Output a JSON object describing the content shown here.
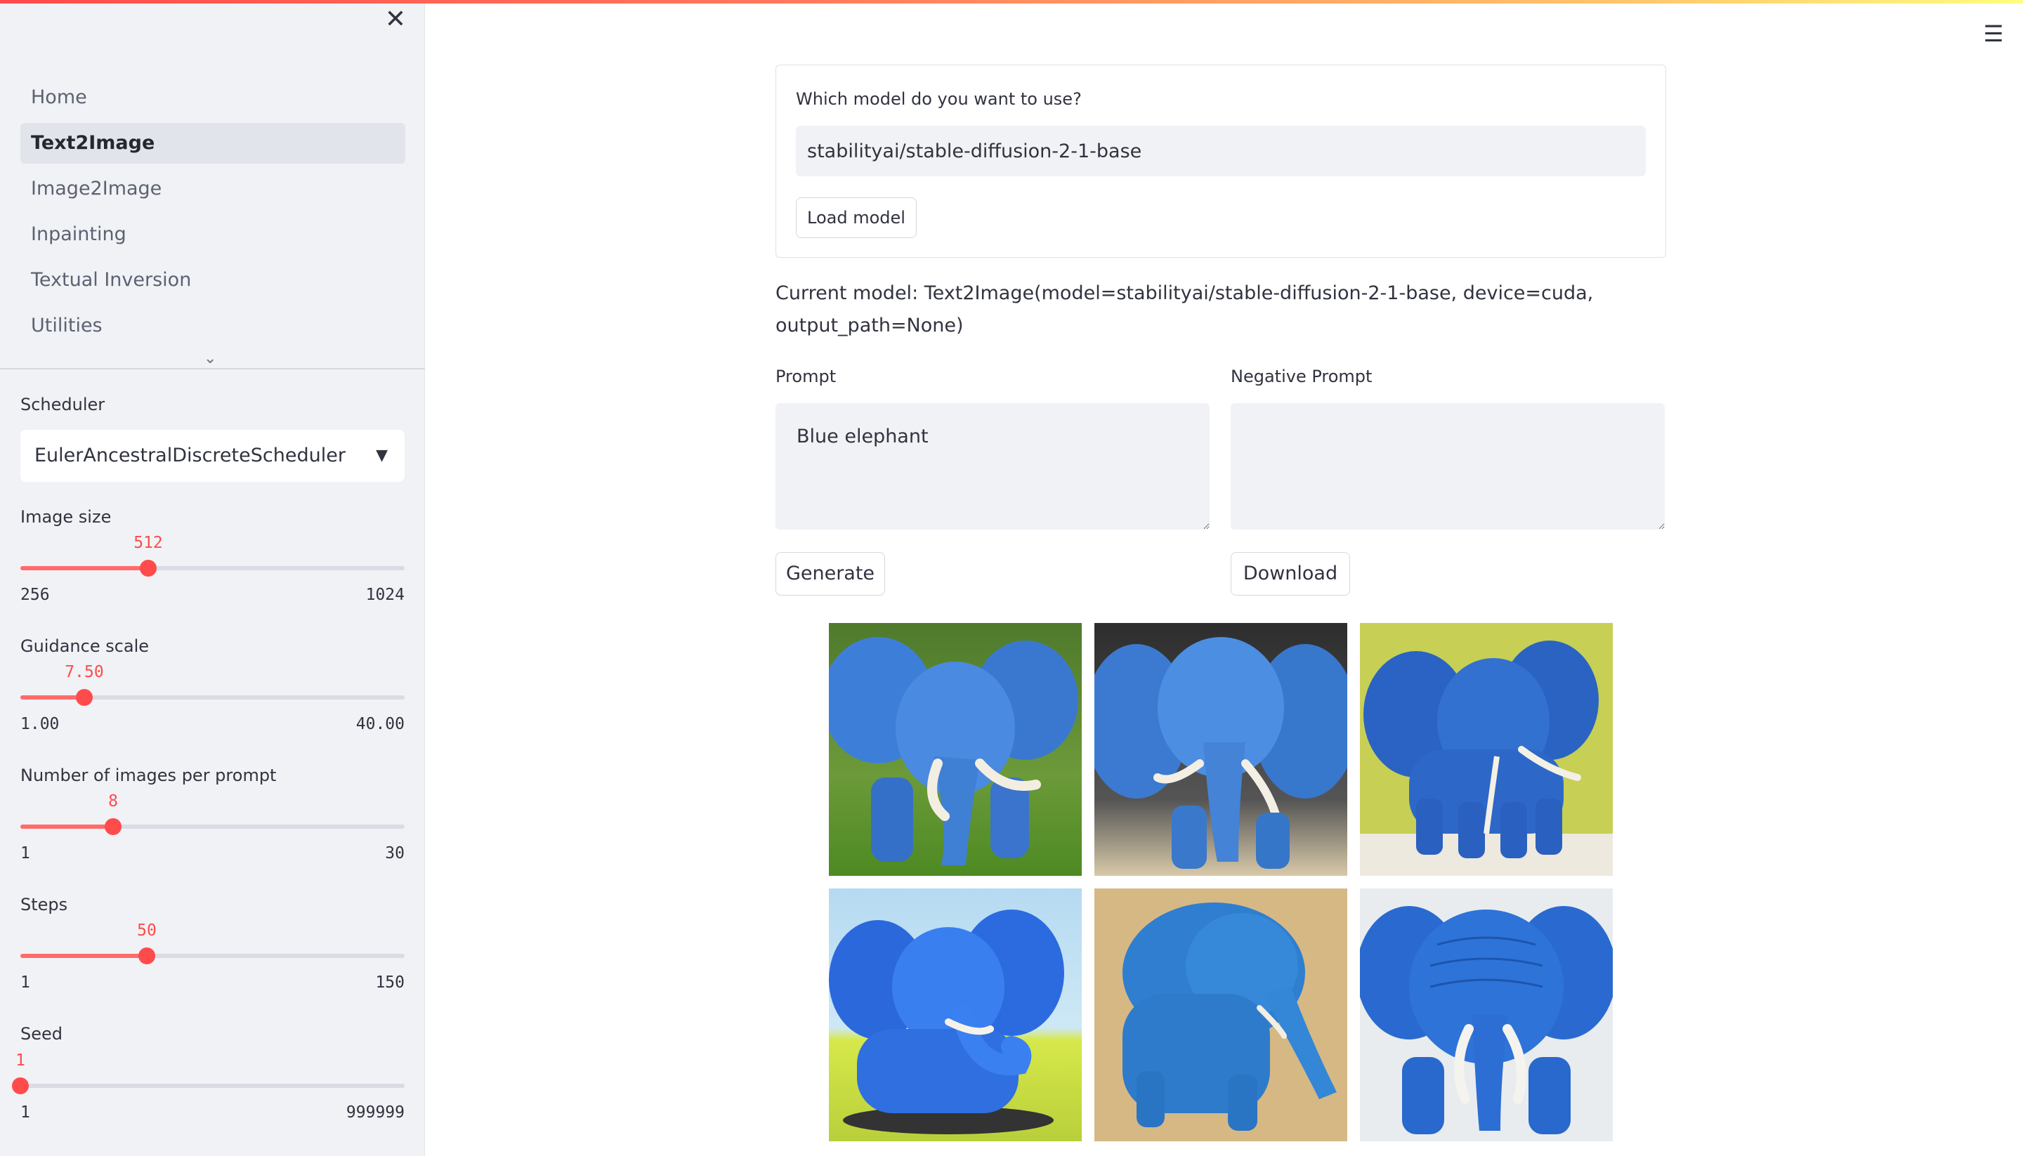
{
  "sidebar": {
    "nav_items": [
      {
        "label": "Home",
        "active": false
      },
      {
        "label": "Text2Image",
        "active": true
      },
      {
        "label": "Image2Image",
        "active": false
      },
      {
        "label": "Inpainting",
        "active": false
      },
      {
        "label": "Textual Inversion",
        "active": false
      },
      {
        "label": "Utilities",
        "active": false
      }
    ],
    "scheduler": {
      "label": "Scheduler",
      "value": "EulerAncestralDiscreteScheduler"
    },
    "sliders": [
      {
        "label": "Image size",
        "value": "512",
        "min": "256",
        "max": "1024",
        "fraction": 0.333
      },
      {
        "label": "Guidance scale",
        "value": "7.50",
        "min": "1.00",
        "max": "40.00",
        "fraction": 0.167
      },
      {
        "label": "Number of images per prompt",
        "value": "8",
        "min": "1",
        "max": "30",
        "fraction": 0.241
      },
      {
        "label": "Steps",
        "value": "50",
        "min": "1",
        "max": "150",
        "fraction": 0.329
      },
      {
        "label": "Seed",
        "value": "1",
        "min": "1",
        "max": "999999",
        "fraction": 0.0
      }
    ]
  },
  "main": {
    "model_label": "Which model do you want to use?",
    "model_value": "stabilityai/stable-diffusion-2-1-base",
    "load_button": "Load model",
    "current_model": "Current model: Text2Image(model=stabilityai/stable-diffusion-2-1-base, device=cuda, output_path=None)",
    "prompt_label": "Prompt",
    "prompt_value": "Blue elephant",
    "negative_label": "Negative Prompt",
    "negative_value": "",
    "generate_button": "Generate",
    "download_button": "Download"
  },
  "icons": {
    "close": "close-icon",
    "menu": "hamburger-menu-icon",
    "chevron": "chevron-down-icon",
    "caret": "caret-down-icon"
  },
  "colors": {
    "accent": "#ff4b4b",
    "sidebar_bg": "#f0f2f6",
    "input_bg": "#f0f2f6"
  }
}
